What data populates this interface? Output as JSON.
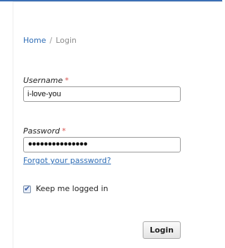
{
  "breadcrumb": {
    "home": "Home",
    "separator": "/",
    "current": "Login"
  },
  "form": {
    "username": {
      "label": "Username",
      "required_marker": "*",
      "value": "i-love-you"
    },
    "password": {
      "label": "Password",
      "required_marker": "*",
      "value": "•••••••••••••••"
    },
    "forgot_password_link": "Forgot your password?",
    "remember_me": {
      "label": "Keep me logged in",
      "checked": true
    },
    "login_button": "Login"
  },
  "colors": {
    "accent_bar": "#3a6fb5",
    "link": "#2d6cb5",
    "required": "#d9534f"
  }
}
